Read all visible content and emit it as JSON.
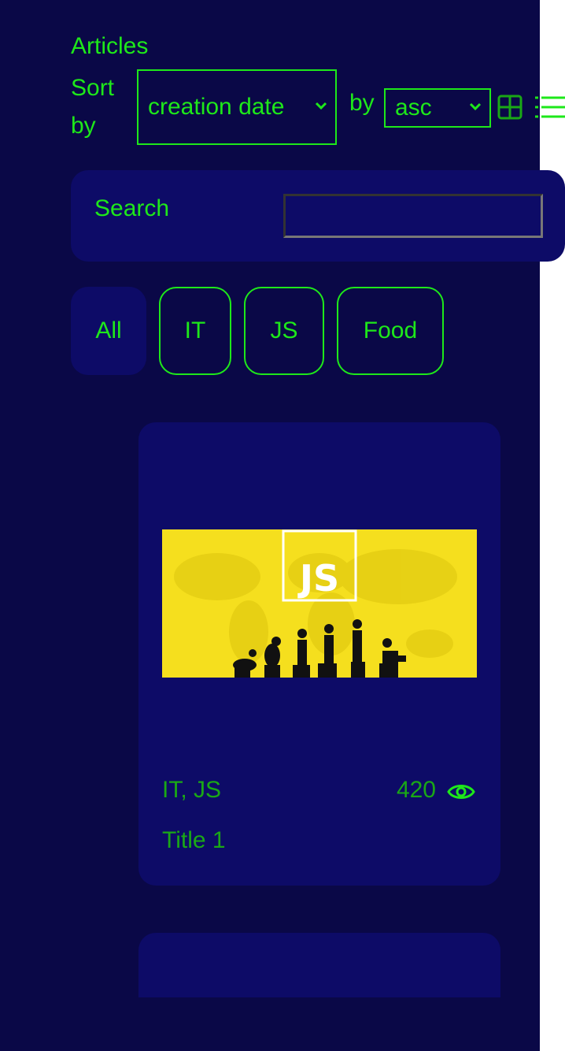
{
  "header": {
    "title": "Articles",
    "sort_label": "Sort by",
    "sort_field": "creation date",
    "by_label": "by",
    "sort_order": "asc",
    "view_modes": [
      "grid-icon",
      "list-icon"
    ]
  },
  "search": {
    "label": "Search",
    "value": "",
    "placeholder": ""
  },
  "tabs": [
    {
      "label": "All",
      "active": true
    },
    {
      "label": "IT",
      "active": false
    },
    {
      "label": "JS",
      "active": false
    },
    {
      "label": "Food",
      "active": false
    }
  ],
  "articles": [
    {
      "image": "js-evolution-banner",
      "image_text": "JS",
      "tags": "IT, JS",
      "views": "420",
      "title": "Title 1"
    },
    {
      "image": "",
      "tags": "",
      "views": "",
      "title": ""
    }
  ],
  "colors": {
    "background": "#0a0847",
    "card": "#0d0b67",
    "accent": "#1ee81a",
    "muted_accent": "#1aa816",
    "banner": "#f5df1e"
  }
}
